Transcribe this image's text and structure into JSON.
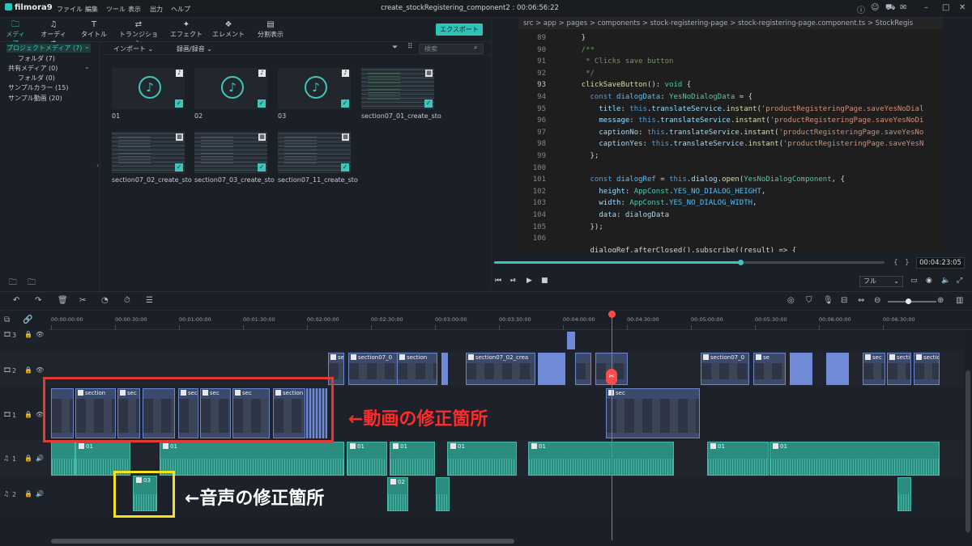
{
  "app": {
    "name": "filmora9",
    "title": "create_stockRegistering_component2 : 00:06:56:22"
  },
  "menu": [
    "ファイル",
    "編集",
    "ツール",
    "表示",
    "出力",
    "ヘルプ"
  ],
  "window_icons": [
    "info-icon",
    "account-icon",
    "cart-icon",
    "mail-icon",
    "minimize-icon",
    "maximize-icon",
    "close-icon"
  ],
  "toolbar": {
    "tabs": [
      {
        "label": "メディア",
        "icon": "folder-icon",
        "active": true
      },
      {
        "label": "オーディオ",
        "icon": "music-icon"
      },
      {
        "label": "タイトル",
        "icon": "text-icon"
      },
      {
        "label": "トランジション",
        "icon": "transition-icon"
      },
      {
        "label": "エフェクト",
        "icon": "effects-icon"
      },
      {
        "label": "エレメント",
        "icon": "elements-icon"
      },
      {
        "label": "分割表示",
        "icon": "split-screen-icon"
      }
    ],
    "export_label": "エクスポート"
  },
  "library": {
    "items": [
      {
        "label": "プロジェクトメディア (7)",
        "selected": true
      },
      {
        "label": "フォルダ (7)"
      },
      {
        "label": "共有メディア (0)"
      },
      {
        "label": "フォルダ (0)"
      },
      {
        "label": "サンプルカラー (15)"
      },
      {
        "label": "サンプル動画 (20)"
      }
    ]
  },
  "media": {
    "import_label": "インポート",
    "record_label": "録画/録音",
    "search_placeholder": "検索",
    "items": [
      {
        "name": "01",
        "type": "audio"
      },
      {
        "name": "02",
        "type": "audio"
      },
      {
        "name": "03",
        "type": "audio"
      },
      {
        "name": "section07_01_create_sto",
        "type": "video"
      },
      {
        "name": "section07_02_create_sto",
        "type": "video"
      },
      {
        "name": "section07_03_create_sto",
        "type": "video"
      },
      {
        "name": "section07_11_create_sto",
        "type": "video"
      }
    ]
  },
  "preview": {
    "breadcrumb": "src > app > pages > components > stock-registering-page > stock-registering-page.component.ts > StockRegis",
    "code_lines": [
      {
        "n": "89",
        "tokens": [
          [
            "    }",
            "pl"
          ]
        ]
      },
      {
        "n": "90",
        "tokens": [
          [
            "    /**",
            "cm"
          ]
        ]
      },
      {
        "n": "91",
        "tokens": [
          [
            "     * Clicks save button",
            "cm"
          ]
        ]
      },
      {
        "n": "92",
        "tokens": [
          [
            "     */",
            "cm"
          ]
        ]
      },
      {
        "n": "93",
        "cur": true,
        "tokens": [
          [
            "    ",
            "pl"
          ],
          [
            "clickSaveButton",
            "fn"
          ],
          [
            "(): ",
            "pl"
          ],
          [
            "void",
            "ty"
          ],
          [
            " {",
            "pl"
          ]
        ]
      },
      {
        "n": "94",
        "tokens": [
          [
            "      ",
            "pl"
          ],
          [
            "const ",
            "kw"
          ],
          [
            "dialogData",
            "id"
          ],
          [
            ": ",
            "pl"
          ],
          [
            "YesNoDialogData",
            "ty"
          ],
          [
            " = {",
            "pl"
          ]
        ]
      },
      {
        "n": "95",
        "tokens": [
          [
            "        ",
            "pl"
          ],
          [
            "title",
            "pr"
          ],
          [
            ": ",
            "pl"
          ],
          [
            "this",
            "kw"
          ],
          [
            ".",
            "pl"
          ],
          [
            "translateService",
            "pr"
          ],
          [
            ".",
            "pl"
          ],
          [
            "instant",
            "fn"
          ],
          [
            "(",
            "pl"
          ],
          [
            "'productRegisteringPage.saveYesNoDial",
            "st"
          ]
        ]
      },
      {
        "n": "96",
        "tokens": [
          [
            "        ",
            "pl"
          ],
          [
            "message",
            "pr"
          ],
          [
            ": ",
            "pl"
          ],
          [
            "this",
            "kw"
          ],
          [
            ".",
            "pl"
          ],
          [
            "translateService",
            "pr"
          ],
          [
            ".",
            "pl"
          ],
          [
            "instant",
            "fn"
          ],
          [
            "(",
            "pl"
          ],
          [
            "'productRegisteringPage.saveYesNoDi",
            "st"
          ]
        ]
      },
      {
        "n": "97",
        "tokens": [
          [
            "        ",
            "pl"
          ],
          [
            "captionNo",
            "pr"
          ],
          [
            ": ",
            "pl"
          ],
          [
            "this",
            "kw"
          ],
          [
            ".",
            "pl"
          ],
          [
            "translateService",
            "pr"
          ],
          [
            ".",
            "pl"
          ],
          [
            "instant",
            "fn"
          ],
          [
            "(",
            "pl"
          ],
          [
            "'productRegisteringPage.saveYesNo",
            "st"
          ]
        ]
      },
      {
        "n": "98",
        "tokens": [
          [
            "        ",
            "pl"
          ],
          [
            "captionYes",
            "pr"
          ],
          [
            ": ",
            "pl"
          ],
          [
            "this",
            "kw"
          ],
          [
            ".",
            "pl"
          ],
          [
            "translateService",
            "pr"
          ],
          [
            ".",
            "pl"
          ],
          [
            "instant",
            "fn"
          ],
          [
            "(",
            "pl"
          ],
          [
            "'productRegisteringPage.saveYesN",
            "st"
          ]
        ]
      },
      {
        "n": "99",
        "tokens": [
          [
            "      };",
            "pl"
          ]
        ]
      },
      {
        "n": "100",
        "tokens": [
          [
            "",
            "pl"
          ]
        ]
      },
      {
        "n": "101",
        "tokens": [
          [
            "      ",
            "pl"
          ],
          [
            "const ",
            "kw"
          ],
          [
            "dialogRef",
            "id"
          ],
          [
            " = ",
            "pl"
          ],
          [
            "this",
            "kw"
          ],
          [
            ".",
            "pl"
          ],
          [
            "dialog",
            "pr"
          ],
          [
            ".",
            "pl"
          ],
          [
            "open",
            "fn"
          ],
          [
            "(",
            "pl"
          ],
          [
            "YesNoDialogComponent",
            "ty"
          ],
          [
            ", {",
            "pl"
          ]
        ]
      },
      {
        "n": "102",
        "tokens": [
          [
            "        ",
            "pl"
          ],
          [
            "height",
            "pr"
          ],
          [
            ": ",
            "pl"
          ],
          [
            "AppConst",
            "ty"
          ],
          [
            ".",
            "pl"
          ],
          [
            "YES_NO_DIALOG_HEIGHT",
            "id"
          ],
          [
            ",",
            "pl"
          ]
        ]
      },
      {
        "n": "103",
        "tokens": [
          [
            "        ",
            "pl"
          ],
          [
            "width",
            "pr"
          ],
          [
            ": ",
            "pl"
          ],
          [
            "AppConst",
            "ty"
          ],
          [
            ".",
            "pl"
          ],
          [
            "YES_NO_DIALOG_WIDTH",
            "id"
          ],
          [
            ",",
            "pl"
          ]
        ]
      },
      {
        "n": "104",
        "tokens": [
          [
            "        ",
            "pl"
          ],
          [
            "data",
            "pr"
          ],
          [
            ": ",
            "pl"
          ],
          [
            "dialogData",
            "pr"
          ]
        ]
      },
      {
        "n": "105",
        "tokens": [
          [
            "      });",
            "pl"
          ]
        ]
      },
      {
        "n": "106",
        "tokens": [
          [
            "",
            "pl"
          ]
        ]
      },
      {
        "n": "",
        "tokens": [
          [
            "      dialogRef.afterClosed().subscribe((result) => {",
            "pl"
          ]
        ]
      }
    ],
    "progress": 0.63,
    "timecode": "00:04:23:05",
    "quality": "フル"
  },
  "timeline": {
    "ruler": [
      "00:00:00:00",
      "00:00:30:00",
      "00:01:00:00",
      "00:01:30:00",
      "00:02:00:00",
      "00:02:30:00",
      "00:03:00:00",
      "00:03:30:00",
      "00:04:00:00",
      "00:04:30:00",
      "00:05:00:00",
      "00:05:30:00",
      "00:06:00:00",
      "00:06:30:00"
    ],
    "tracks": [
      {
        "label": "3",
        "kind": "video"
      },
      {
        "label": "2",
        "kind": "video"
      },
      {
        "label": "1",
        "kind": "video"
      },
      {
        "label": "1",
        "kind": "audio"
      },
      {
        "label": "2",
        "kind": "audio"
      }
    ],
    "clip_labels": {
      "v2_a": "se",
      "v2_b": "section07_0",
      "v2_c": "section",
      "v2_d": "section07_02_crea",
      "v2_e": "section07_0",
      "v2_f": "se",
      "v2_g": "sec",
      "v2_h": "section07_0",
      "v2_i": "sectio",
      "v2_j": "sectio",
      "v1_a": "section",
      "v1_b": "sec",
      "v1_c": "sec",
      "v1_d": "sec",
      "v1_e": "sec",
      "v1_f": "section",
      "a_01": "01",
      "a_03": "03",
      "a_02": "02"
    }
  },
  "annotations": {
    "video_fix": "←動画の修正箇所",
    "audio_fix": "←音声の修正箇所"
  }
}
